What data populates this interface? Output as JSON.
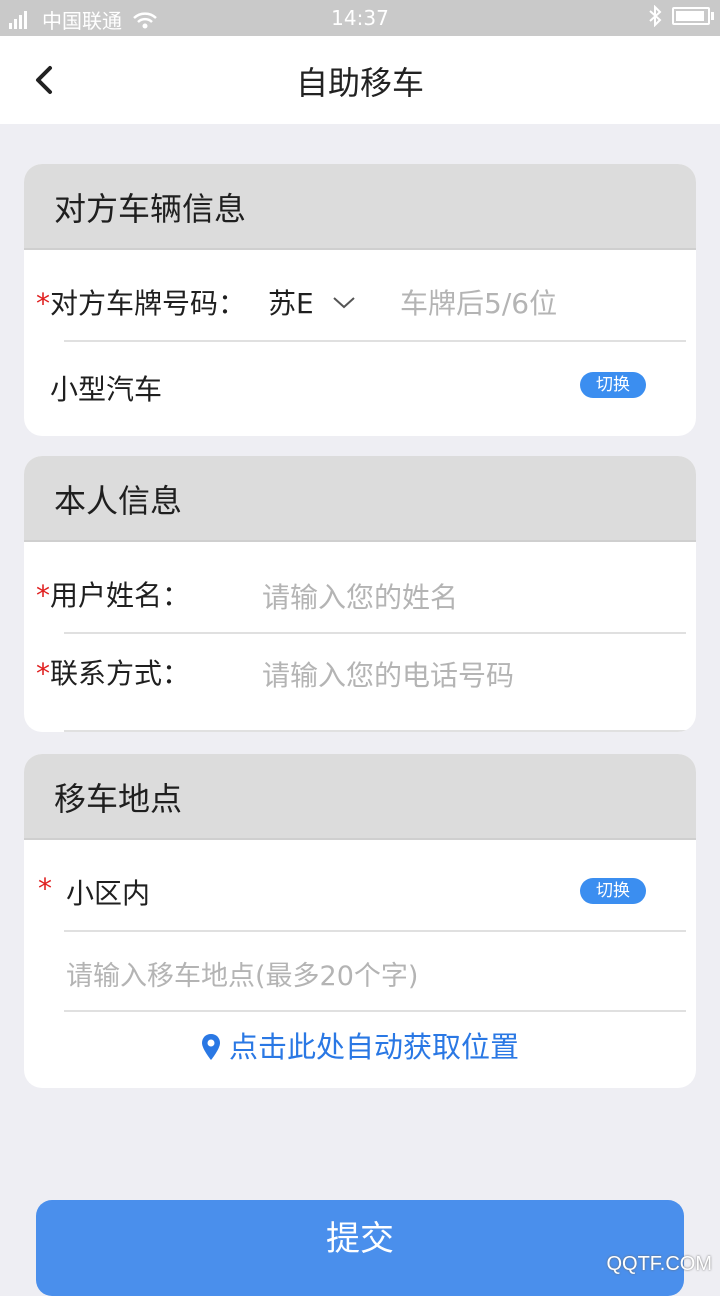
{
  "status_bar": {
    "carrier": "中国联通",
    "time": "14:37"
  },
  "nav": {
    "title": "自助移车"
  },
  "other_vehicle": {
    "title": "对方车辆信息",
    "plate_label": "对方车牌号码：",
    "plate_prefix": "苏E",
    "plate_placeholder": "车牌后5/6位",
    "vehicle_type": "小型汽车",
    "switch_label": "切换"
  },
  "personal": {
    "title": "本人信息",
    "name_label": "用户姓名：",
    "name_placeholder": "请输入您的姓名",
    "phone_label": "联系方式：",
    "phone_placeholder": "请输入您的电话号码"
  },
  "location": {
    "title": "移车地点",
    "area_value": "小区内",
    "switch_label": "切换",
    "address_placeholder": "请输入移车地点(最多20个字)",
    "auto_locate_label": "点击此处自动获取位置"
  },
  "required_mark": "*",
  "submit_label": "提交",
  "watermark": "QQTF.COM",
  "colors": {
    "accent": "#4a8fec",
    "required": "#e02020",
    "header_bg": "#dcdcdc",
    "page_bg": "#eeeef3"
  }
}
